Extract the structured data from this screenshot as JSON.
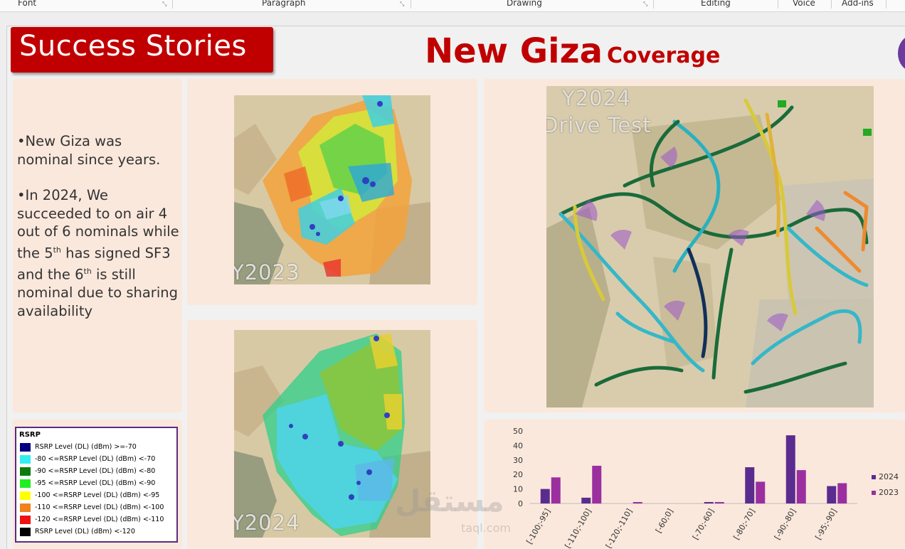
{
  "ribbon": {
    "groups": [
      "Font",
      "Paragraph",
      "Drawing",
      "Editing",
      "Voice",
      "Add-ins"
    ]
  },
  "slide": {
    "banner": "Success Stories",
    "title_main": "New Giza",
    "title_sub": "Coverage",
    "bullet1": "•New Giza was nominal since years.",
    "bullet2_a": "•In 2024, We succeeded to on air 4 out of 6 nominals while the 5",
    "bullet2_sup1": "th",
    "bullet2_b": " has signed SF3 and the 6",
    "bullet2_sup2": "th",
    "bullet2_c": " is still nominal due to sharing availability",
    "map_y2023_label": "Y2023",
    "map_y2024_label": "Y2024",
    "drive_label_1": "Y2024",
    "drive_label_2": "Drive Test"
  },
  "legend": {
    "title": "RSRP",
    "items": [
      {
        "label": "RSRP Level (DL) (dBm) >=-70",
        "color": "#000080"
      },
      {
        "label": "-80 <=RSRP Level (DL) (dBm) <-70",
        "color": "#33eeee"
      },
      {
        "label": "-90 <=RSRP Level (DL) (dBm) <-80",
        "color": "#0e7a0e"
      },
      {
        "label": "-95 <=RSRP Level (DL) (dBm) <-90",
        "color": "#22ee22"
      },
      {
        "label": "-100 <=RSRP Level (DL) (dBm) <-95",
        "color": "#ffff00"
      },
      {
        "label": "-110 <=RSRP Level (DL) (dBm) <-100",
        "color": "#f08020"
      },
      {
        "label": "-120 <=RSRP Level (DL) (dBm) <-110",
        "color": "#ee1111"
      },
      {
        "label": "RSRP Level (DL) (dBm) <-120",
        "color": "#000000"
      }
    ]
  },
  "chart_data": {
    "type": "bar",
    "categories": [
      "[-100;-95]",
      "[-110;-100]",
      "[-120;-110]",
      "[-60;0]",
      "[-70;-60]",
      "[-80;-70]",
      "[-90;-80]",
      "[-95;-90]"
    ],
    "series": [
      {
        "name": "2024",
        "values": [
          10,
          4,
          0,
          0,
          1,
          25,
          47,
          12
        ],
        "color": "#5b2c8f"
      },
      {
        "name": "2023",
        "values": [
          18,
          26,
          1,
          0,
          1,
          15,
          23,
          14
        ],
        "color": "#9b2fa0"
      }
    ],
    "yticks": [
      "0",
      "10",
      "20",
      "30",
      "40",
      "50"
    ],
    "ylim": [
      0,
      50
    ],
    "legend_position": "right"
  },
  "watermark": {
    "text": "مستقل",
    "sub": "taql.com"
  }
}
